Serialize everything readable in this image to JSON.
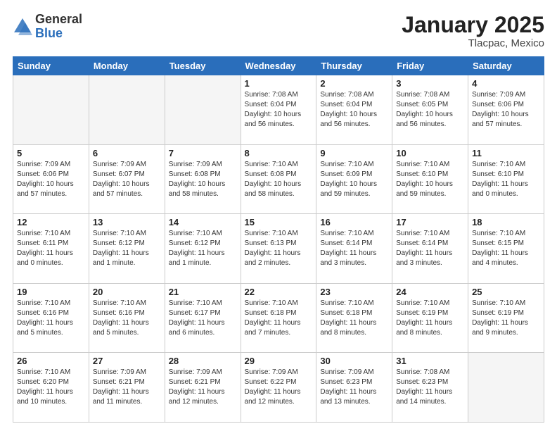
{
  "logo": {
    "general": "General",
    "blue": "Blue"
  },
  "title": "January 2025",
  "location": "Tlacpac, Mexico",
  "days_header": [
    "Sunday",
    "Monday",
    "Tuesday",
    "Wednesday",
    "Thursday",
    "Friday",
    "Saturday"
  ],
  "weeks": [
    [
      {
        "num": "",
        "info": ""
      },
      {
        "num": "",
        "info": ""
      },
      {
        "num": "",
        "info": ""
      },
      {
        "num": "1",
        "info": "Sunrise: 7:08 AM\nSunset: 6:04 PM\nDaylight: 10 hours\nand 56 minutes."
      },
      {
        "num": "2",
        "info": "Sunrise: 7:08 AM\nSunset: 6:04 PM\nDaylight: 10 hours\nand 56 minutes."
      },
      {
        "num": "3",
        "info": "Sunrise: 7:08 AM\nSunset: 6:05 PM\nDaylight: 10 hours\nand 56 minutes."
      },
      {
        "num": "4",
        "info": "Sunrise: 7:09 AM\nSunset: 6:06 PM\nDaylight: 10 hours\nand 57 minutes."
      }
    ],
    [
      {
        "num": "5",
        "info": "Sunrise: 7:09 AM\nSunset: 6:06 PM\nDaylight: 10 hours\nand 57 minutes."
      },
      {
        "num": "6",
        "info": "Sunrise: 7:09 AM\nSunset: 6:07 PM\nDaylight: 10 hours\nand 57 minutes."
      },
      {
        "num": "7",
        "info": "Sunrise: 7:09 AM\nSunset: 6:08 PM\nDaylight: 10 hours\nand 58 minutes."
      },
      {
        "num": "8",
        "info": "Sunrise: 7:10 AM\nSunset: 6:08 PM\nDaylight: 10 hours\nand 58 minutes."
      },
      {
        "num": "9",
        "info": "Sunrise: 7:10 AM\nSunset: 6:09 PM\nDaylight: 10 hours\nand 59 minutes."
      },
      {
        "num": "10",
        "info": "Sunrise: 7:10 AM\nSunset: 6:10 PM\nDaylight: 10 hours\nand 59 minutes."
      },
      {
        "num": "11",
        "info": "Sunrise: 7:10 AM\nSunset: 6:10 PM\nDaylight: 11 hours\nand 0 minutes."
      }
    ],
    [
      {
        "num": "12",
        "info": "Sunrise: 7:10 AM\nSunset: 6:11 PM\nDaylight: 11 hours\nand 0 minutes."
      },
      {
        "num": "13",
        "info": "Sunrise: 7:10 AM\nSunset: 6:12 PM\nDaylight: 11 hours\nand 1 minute."
      },
      {
        "num": "14",
        "info": "Sunrise: 7:10 AM\nSunset: 6:12 PM\nDaylight: 11 hours\nand 1 minute."
      },
      {
        "num": "15",
        "info": "Sunrise: 7:10 AM\nSunset: 6:13 PM\nDaylight: 11 hours\nand 2 minutes."
      },
      {
        "num": "16",
        "info": "Sunrise: 7:10 AM\nSunset: 6:14 PM\nDaylight: 11 hours\nand 3 minutes."
      },
      {
        "num": "17",
        "info": "Sunrise: 7:10 AM\nSunset: 6:14 PM\nDaylight: 11 hours\nand 3 minutes."
      },
      {
        "num": "18",
        "info": "Sunrise: 7:10 AM\nSunset: 6:15 PM\nDaylight: 11 hours\nand 4 minutes."
      }
    ],
    [
      {
        "num": "19",
        "info": "Sunrise: 7:10 AM\nSunset: 6:16 PM\nDaylight: 11 hours\nand 5 minutes."
      },
      {
        "num": "20",
        "info": "Sunrise: 7:10 AM\nSunset: 6:16 PM\nDaylight: 11 hours\nand 5 minutes."
      },
      {
        "num": "21",
        "info": "Sunrise: 7:10 AM\nSunset: 6:17 PM\nDaylight: 11 hours\nand 6 minutes."
      },
      {
        "num": "22",
        "info": "Sunrise: 7:10 AM\nSunset: 6:18 PM\nDaylight: 11 hours\nand 7 minutes."
      },
      {
        "num": "23",
        "info": "Sunrise: 7:10 AM\nSunset: 6:18 PM\nDaylight: 11 hours\nand 8 minutes."
      },
      {
        "num": "24",
        "info": "Sunrise: 7:10 AM\nSunset: 6:19 PM\nDaylight: 11 hours\nand 8 minutes."
      },
      {
        "num": "25",
        "info": "Sunrise: 7:10 AM\nSunset: 6:19 PM\nDaylight: 11 hours\nand 9 minutes."
      }
    ],
    [
      {
        "num": "26",
        "info": "Sunrise: 7:10 AM\nSunset: 6:20 PM\nDaylight: 11 hours\nand 10 minutes."
      },
      {
        "num": "27",
        "info": "Sunrise: 7:09 AM\nSunset: 6:21 PM\nDaylight: 11 hours\nand 11 minutes."
      },
      {
        "num": "28",
        "info": "Sunrise: 7:09 AM\nSunset: 6:21 PM\nDaylight: 11 hours\nand 12 minutes."
      },
      {
        "num": "29",
        "info": "Sunrise: 7:09 AM\nSunset: 6:22 PM\nDaylight: 11 hours\nand 12 minutes."
      },
      {
        "num": "30",
        "info": "Sunrise: 7:09 AM\nSunset: 6:23 PM\nDaylight: 11 hours\nand 13 minutes."
      },
      {
        "num": "31",
        "info": "Sunrise: 7:08 AM\nSunset: 6:23 PM\nDaylight: 11 hours\nand 14 minutes."
      },
      {
        "num": "",
        "info": ""
      }
    ]
  ]
}
